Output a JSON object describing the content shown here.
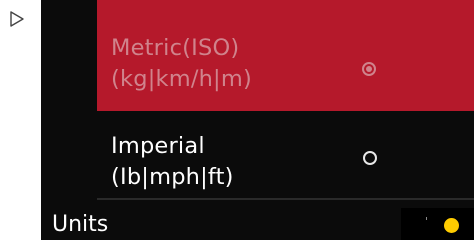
{
  "icons": {
    "play": "play-outline-triangle-icon",
    "radio_selected": "radio-selected-icon",
    "radio_unselected": "radio-unselected-icon"
  },
  "colors": {
    "selected_bg": "#b5192b",
    "selected_text": "#d0838c",
    "screen_bg": "#0b0b0b",
    "status_dot": "#ffcc00"
  },
  "units": {
    "options": [
      {
        "line1": "Metric(ISO)",
        "line2": "(kg|km/h|m)",
        "selected": true
      },
      {
        "line1": "Imperial",
        "line2": "(Ib|mph|ft)",
        "selected": false
      }
    ],
    "title": "Units"
  }
}
